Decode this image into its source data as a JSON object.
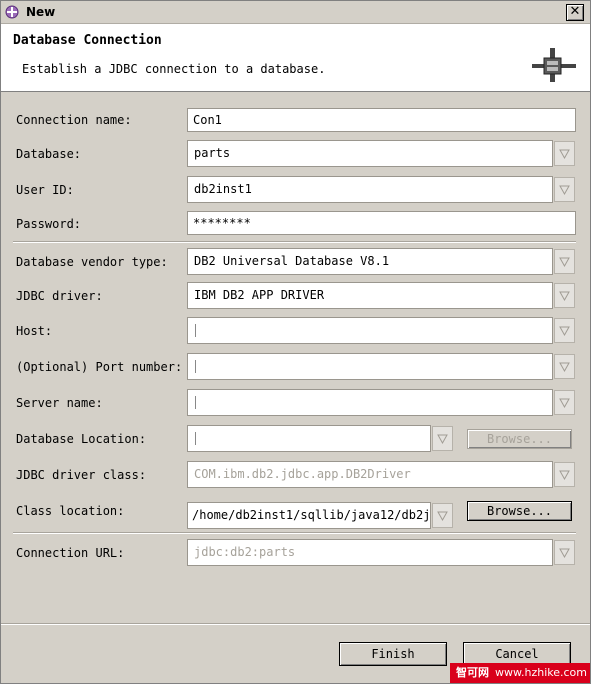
{
  "window": {
    "title": "New"
  },
  "header": {
    "title": "Database Connection",
    "description": "Establish a JDBC connection to a database."
  },
  "form": {
    "connection_name": {
      "label": "Connection name:",
      "value": "Con1"
    },
    "database": {
      "label": "Database:",
      "value": "parts"
    },
    "user_id": {
      "label": "User ID:",
      "value": "db2inst1"
    },
    "password": {
      "label": "Password:",
      "value": "********"
    },
    "vendor_type": {
      "label": "Database vendor type:",
      "value": "DB2 Universal Database V8.1"
    },
    "jdbc_driver": {
      "label": "JDBC driver:",
      "value": "IBM DB2 APP DRIVER"
    },
    "host": {
      "label": "Host:",
      "value": ""
    },
    "port": {
      "label": "(Optional) Port number:",
      "value": ""
    },
    "server_name": {
      "label": "Server name:",
      "value": ""
    },
    "db_location": {
      "label": "Database Location:",
      "value": ""
    },
    "driver_class": {
      "label": "JDBC driver class:",
      "value": "COM.ibm.db2.jdbc.app.DB2Driver"
    },
    "class_location": {
      "label": "Class location:",
      "value": "/home/db2inst1/sqllib/java12/db2j"
    },
    "connection_url": {
      "label": "Connection URL:",
      "value": "jdbc:db2:parts"
    }
  },
  "buttons": {
    "browse_db_location": "Browse...",
    "browse_class_location": "Browse...",
    "finish": "Finish",
    "cancel": "Cancel"
  },
  "watermark": {
    "cn": "智可网",
    "url": "www.hzhike.com"
  },
  "colors": {
    "watermark_bg": "#d9001b",
    "dialog_bg": "#d4d0c8"
  }
}
